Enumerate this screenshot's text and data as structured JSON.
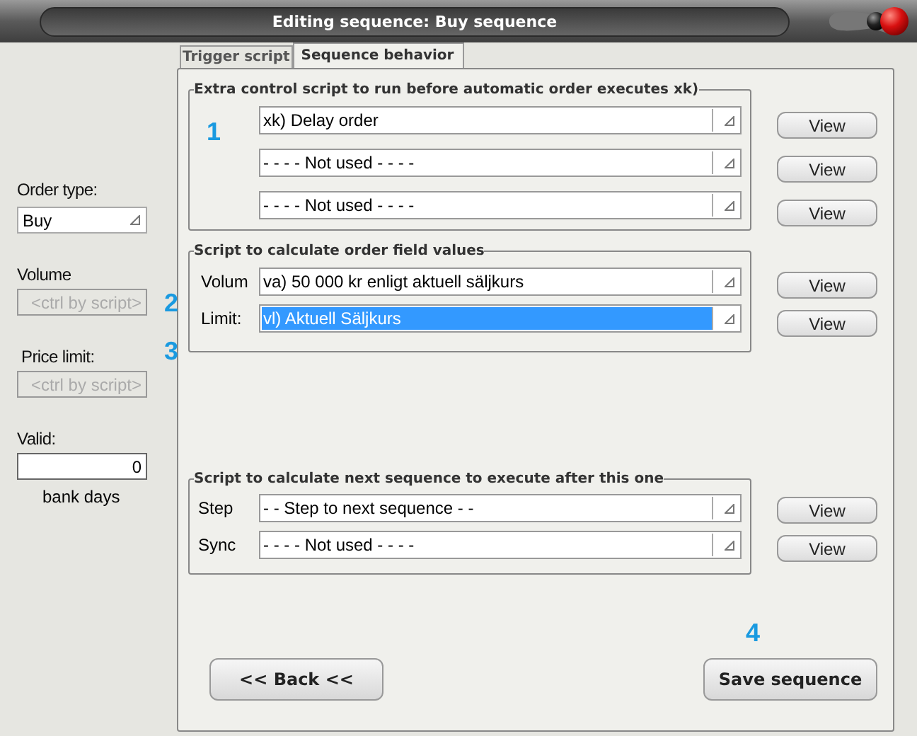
{
  "window": {
    "title": "Editing sequence: Buy sequence"
  },
  "tabs": [
    {
      "label": "Trigger script",
      "selected": false
    },
    {
      "label": "Sequence behavior",
      "selected": true
    }
  ],
  "left_panel": {
    "fields": [
      {
        "kind": "combo",
        "label": "Order type:",
        "value": "Buy",
        "disabled": false
      },
      {
        "kind": "text",
        "label": "Volume",
        "placeholder": "<ctrl by script>",
        "disabled": true
      },
      {
        "kind": "text",
        "label": "Price limit:",
        "placeholder": "<ctrl by script>",
        "disabled": true
      },
      {
        "kind": "number",
        "label": "Valid:",
        "value": "0",
        "unit": "bank days",
        "disabled": false
      }
    ]
  },
  "groups": [
    {
      "title": "Extra control script to run before automatic order executes xk)",
      "rows": [
        {
          "value": "xk) Delay order",
          "selected": false,
          "button": "View"
        },
        {
          "value": "- - - - Not used - - - -",
          "selected": false,
          "button": "View"
        },
        {
          "value": "- - - - Not used - - - -",
          "selected": false,
          "button": "View"
        }
      ]
    },
    {
      "title": "Script to calculate order field values",
      "rows": [
        {
          "label": "Volum",
          "value": "va)  50 000 kr enligt aktuell säljkurs",
          "selected": false,
          "button": "View"
        },
        {
          "label": "Limit:",
          "value": "vl) Aktuell Säljkurs",
          "selected": true,
          "button": "View"
        }
      ]
    },
    {
      "title": "Script to calculate next sequence to execute after this one",
      "rows": [
        {
          "label": "Step",
          "value": "- - Step to next sequence - -",
          "selected": false,
          "button": "View"
        },
        {
          "label": "Sync",
          "value": "- - - - Not used - - - -",
          "selected": false,
          "button": "View"
        }
      ]
    }
  ],
  "buttons": {
    "back": "<< Back <<",
    "save": "Save sequence"
  },
  "annotations": [
    "1",
    "2",
    "3",
    "4"
  ]
}
